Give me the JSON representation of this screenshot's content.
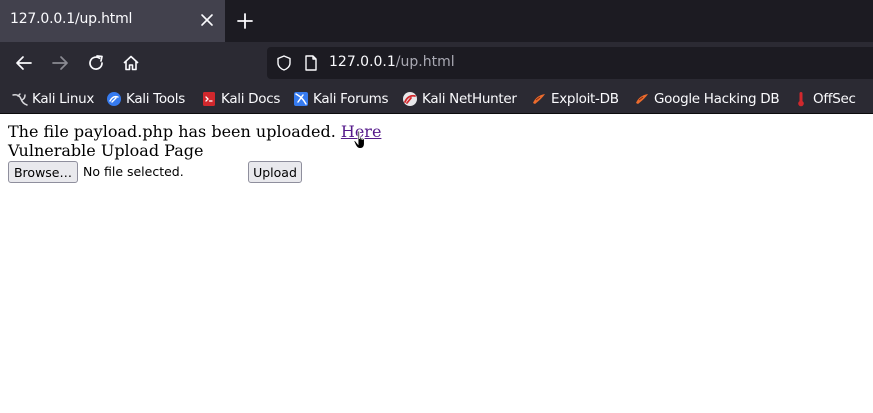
{
  "browser": {
    "tab_title": "127.0.0.1/up.html",
    "url_host": "127.0.0.1",
    "url_path": "/up.html"
  },
  "bookmarks": [
    {
      "label": "Kali Linux",
      "icon": "kali-dragon-icon"
    },
    {
      "label": "Kali Tools",
      "icon": "kali-tools-icon"
    },
    {
      "label": "Kali Docs",
      "icon": "kali-docs-icon"
    },
    {
      "label": "Kali Forums",
      "icon": "kali-forums-icon"
    },
    {
      "label": "Kali NetHunter",
      "icon": "kali-nethunter-icon"
    },
    {
      "label": "Exploit-DB",
      "icon": "exploit-db-icon"
    },
    {
      "label": "Google Hacking DB",
      "icon": "ghdb-icon"
    },
    {
      "label": "OffSec",
      "icon": "offsec-icon"
    }
  ],
  "page": {
    "upload_message": "The file payload.php has been uploaded.",
    "link_text": "Here",
    "heading": "Vulnerable Upload Page",
    "browse_label": "Browse…",
    "file_status": "No file selected.",
    "upload_label": "Upload"
  },
  "colors": {
    "tab_active": "#42414d",
    "tabstrip": "#1c1b22",
    "toolbar": "#2b2a33",
    "link_visited": "#551a8b"
  }
}
